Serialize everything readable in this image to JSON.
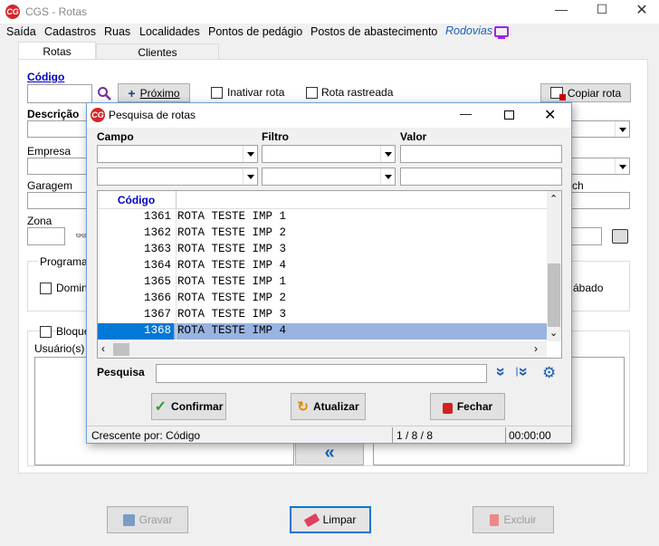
{
  "window": {
    "title": "CGS - Rotas",
    "logo": "CG"
  },
  "menu": [
    "Saída",
    "Cadastros",
    "Ruas",
    "Localidades",
    "Pontos de pedágio",
    "Postos de abastecimento",
    "Rodovias"
  ],
  "tabs": [
    "Rotas",
    "Clientes"
  ],
  "form": {
    "codigo_label": "Código",
    "proximo_label": "Próximo",
    "inativar_label": "Inativar rota",
    "rastreada_label": "Rota rastreada",
    "copiar_label": "Copiar rota",
    "descricao_label": "Descrição",
    "empresa_label": "Empresa",
    "garagem_label": "Garagem",
    "zona_label": "Zona",
    "programacao_label": "Programaç",
    "domingo_label": "Doming",
    "sabado_label": "ábado",
    "bloqueio_label": "Bloque",
    "usuarios_label": "Usuário(s) a",
    "ch_label": "ch"
  },
  "footer": {
    "gravar": "Gravar",
    "limpar": "Limpar",
    "excluir": "Excluir"
  },
  "dialog": {
    "title": "Pesquisa de rotas",
    "campo_label": "Campo",
    "filtro_label": "Filtro",
    "valor_label": "Valor",
    "grid_header": "Código",
    "rows": [
      {
        "code": "1361",
        "desc": "ROTA TESTE IMP 1"
      },
      {
        "code": "1362",
        "desc": "ROTA TESTE IMP 2"
      },
      {
        "code": "1363",
        "desc": "ROTA TESTE IMP 3"
      },
      {
        "code": "1364",
        "desc": "ROTA TESTE IMP 4"
      },
      {
        "code": "1365",
        "desc": "ROTA TESTE IMP 1"
      },
      {
        "code": "1366",
        "desc": "ROTA TESTE IMP 2"
      },
      {
        "code": "1367",
        "desc": "ROTA TESTE IMP 3"
      },
      {
        "code": "1368",
        "desc": "ROTA TESTE IMP 4"
      }
    ],
    "selected_index": 7,
    "pesquisa_label": "Pesquisa",
    "confirmar": "Confirmar",
    "atualizar": "Atualizar",
    "fechar": "Fechar",
    "status_sort": "Crescente por: Código",
    "status_count": "1 / 8 / 8",
    "status_time": "00:00:00"
  },
  "colors": {
    "accent_blue": "#0000c0",
    "selection": "#99b4e1",
    "logo_red": "#d4262c",
    "purple": "#7030a0",
    "link_blue": "#1e5fb4"
  }
}
